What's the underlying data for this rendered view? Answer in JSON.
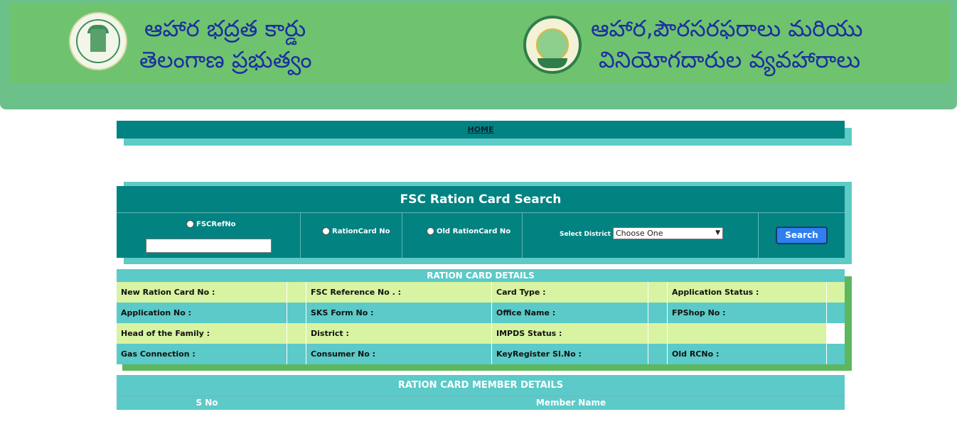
{
  "header": {
    "left_title_line1": "ఆహార భద్రత కార్డు",
    "left_title_line2": "తెలంగాణ ప్రభుత్వం",
    "right_title_line1": "ఆహార,పౌరసరఫరాలు మరియు",
    "right_title_line2": "వినియోగదారుల వ్యవహారాలు",
    "emblem_icon": "telangana-emblem",
    "logo_icon": "tscscl-logo"
  },
  "nav": {
    "home_label": "HOME"
  },
  "search": {
    "title": "FSC Ration Card Search",
    "options": [
      {
        "label": "FSCRefNo"
      },
      {
        "label": "RationCard No"
      },
      {
        "label": "Old RationCard No"
      }
    ],
    "fsc_ref_value": "",
    "district_label": "Select District :",
    "district_selected": "Choose One",
    "search_button": "Search"
  },
  "details": {
    "title": "RATION CARD DETAILS",
    "rows": [
      [
        "New Ration Card No :",
        "FSC Reference No . :",
        "Card Type :",
        "Application Status :"
      ],
      [
        "Application No :",
        "SKS Form No :",
        "Office Name :",
        "FPShop No :"
      ],
      [
        "Head of the Family :",
        "District :",
        "IMPDS Status :",
        ""
      ],
      [
        "Gas Connection :",
        "Consumer No :",
        "KeyRegister Sl.No :",
        "Old RCNo :"
      ]
    ]
  },
  "members": {
    "title": "RATION CARD MEMBER DETAILS",
    "columns": [
      "S No",
      "Member Name"
    ]
  },
  "colors": {
    "teal": "#028281",
    "light_teal": "#5bcac8",
    "light_green": "#d8f3a1",
    "banner_green": "#6fc36e",
    "title_blue": "#1b2fa0",
    "button_blue": "#2e7ff0"
  }
}
